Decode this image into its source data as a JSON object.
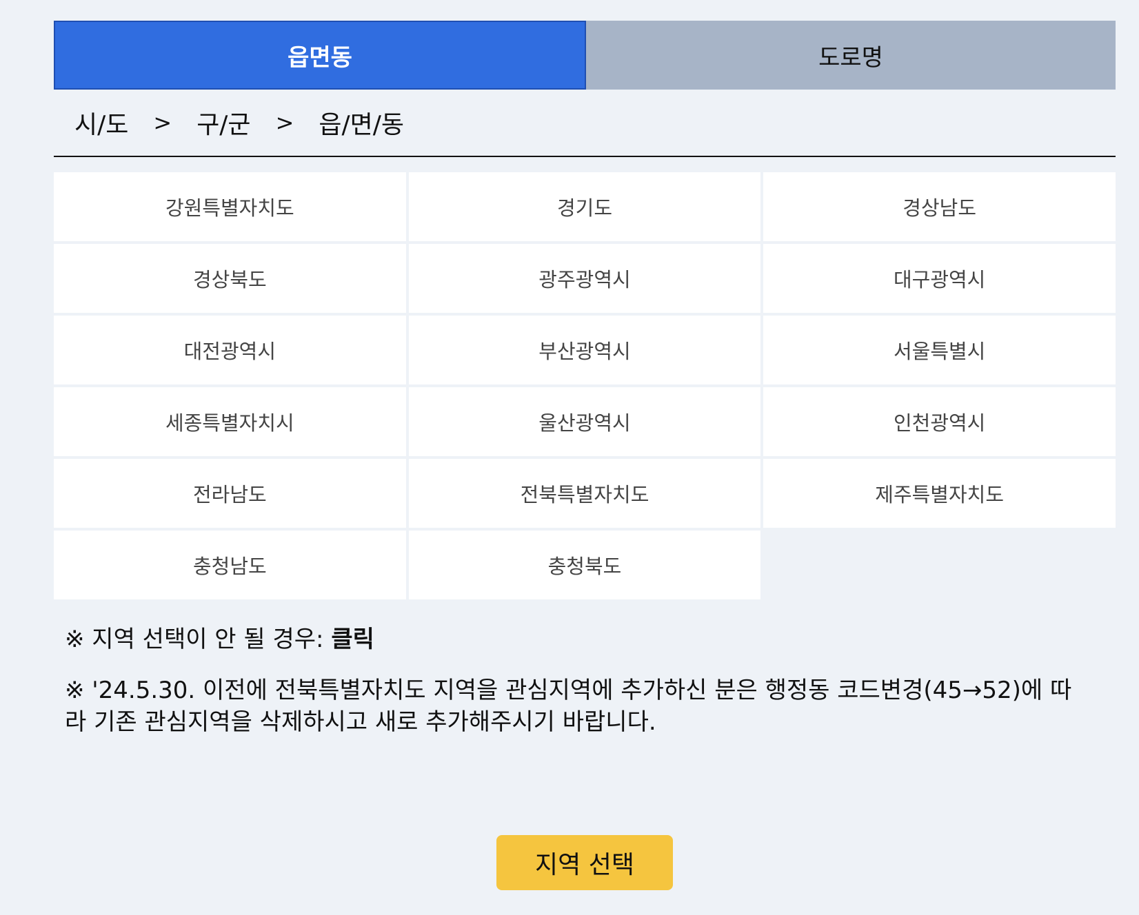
{
  "tabs": [
    {
      "label": "읍면동",
      "active": true
    },
    {
      "label": "도로명",
      "active": false
    }
  ],
  "breadcrumb": {
    "level1": "시/도",
    "level2": "구/군",
    "level3": "읍/면/동",
    "separator": ">"
  },
  "regions": [
    "강원특별자치도",
    "경기도",
    "경상남도",
    "경상북도",
    "광주광역시",
    "대구광역시",
    "대전광역시",
    "부산광역시",
    "서울특별시",
    "세종특별자치시",
    "울산광역시",
    "인천광역시",
    "전라남도",
    "전북특별자치도",
    "제주특별자치도",
    "충청남도",
    "충청북도"
  ],
  "notices": {
    "line1_prefix": "※ 지역 선택이 안 될 경우: ",
    "line1_link": "클릭",
    "line2": "※ '24.5.30. 이전에 전북특별자치도 지역을 관심지역에 추가하신 분은 행정동 코드변경(45→52)에 따라 기존 관심지역을 삭제하시고 새로 추가해주시기 바랍니다."
  },
  "button": {
    "label": "지역 선택"
  },
  "colors": {
    "background": "#eef2f7",
    "active_tab": "#306de0",
    "inactive_tab": "#a7b4c7",
    "button": "#f5c53f"
  }
}
